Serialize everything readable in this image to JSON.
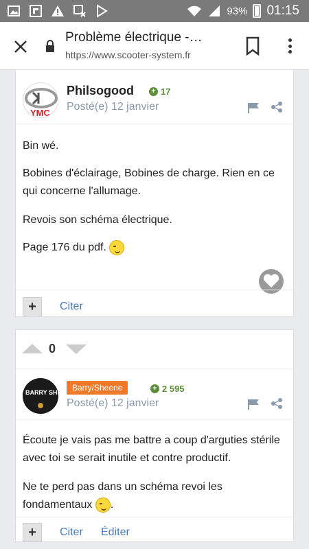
{
  "status_bar": {
    "battery": "93%",
    "time": "01:15"
  },
  "browser": {
    "title": "Problème électrique -…",
    "url": "https://www.scooter-system.fr"
  },
  "posts": [
    {
      "author": "Philsogood",
      "reputation": "17",
      "posted": "Posté(e) 12 janvier",
      "avatar_text": "YMC",
      "paragraphs": [
        "Bin wé.",
        "Bobines d'éclairage, Bobines de charge. Rien en ce qui concerne l'allumage.",
        "Revois son schéma électrique.",
        "Page 176 du pdf."
      ],
      "actions": {
        "plus": "+",
        "quote": "Citer"
      }
    },
    {
      "vote_count": "0",
      "author_badge": "Barry/Sheene",
      "reputation": "2 595",
      "posted": "Posté(e) 12 janvier",
      "avatar_text": "BARRY SHEENE",
      "paragraphs": [
        "Écoute je vais pas me battre a coup d'arguties stérile avec toi se serait inutile et contre productif.",
        "Ne te perd pas dans un schéma revoi les fondamentaux"
      ],
      "actions": {
        "plus": "+",
        "quote": "Citer",
        "edit": "Éditer"
      }
    }
  ],
  "colors": {
    "accent": "#4a7ab7",
    "reputation": "#5c8d39",
    "badge": "#ee7a2a",
    "meta": "#8a9aab"
  }
}
